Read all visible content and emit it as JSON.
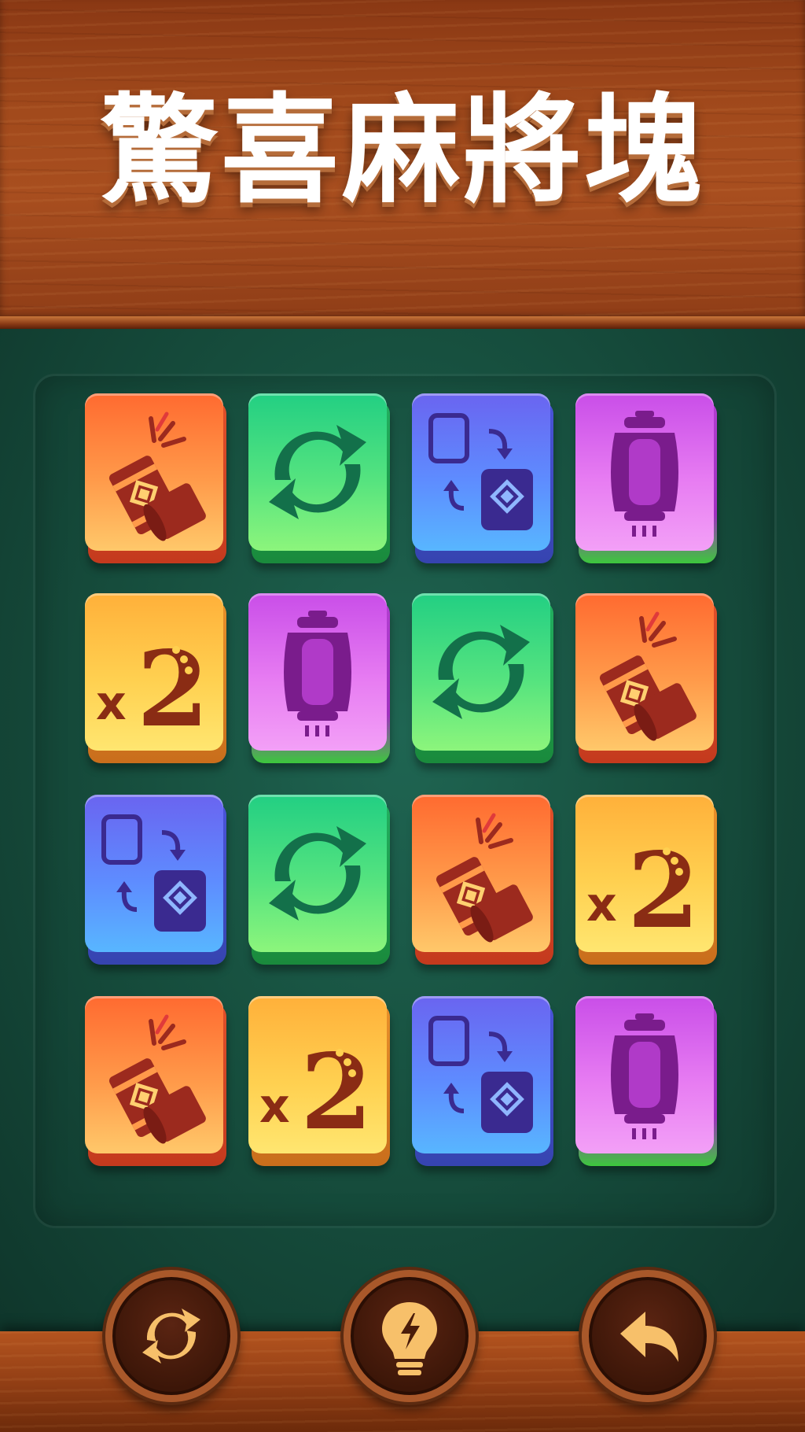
{
  "title": "驚喜麻將塊",
  "tile_icons": [
    "firecracker-icon",
    "swap-arrows-icon",
    "card-swap-icon",
    "lantern-icon",
    "x2-icon"
  ],
  "tiles": [
    [
      "firecracker",
      "arrows",
      "card-swap",
      "lantern"
    ],
    [
      "x2",
      "lantern",
      "arrows",
      "firecracker"
    ],
    [
      "card-swap",
      "arrows",
      "firecracker",
      "x2"
    ],
    [
      "firecracker",
      "x2",
      "card-swap",
      "lantern"
    ]
  ],
  "x2_label": "x2",
  "actions": [
    "shuffle",
    "hint",
    "undo"
  ],
  "colors": {
    "firecracker": "#ff8a40",
    "arrows": "#4ddf80",
    "card-swap": "#5e8cff",
    "lantern": "#e77cf2",
    "x2": "#ffd050",
    "felt": "#17503f",
    "wood": "#a24a1c"
  }
}
